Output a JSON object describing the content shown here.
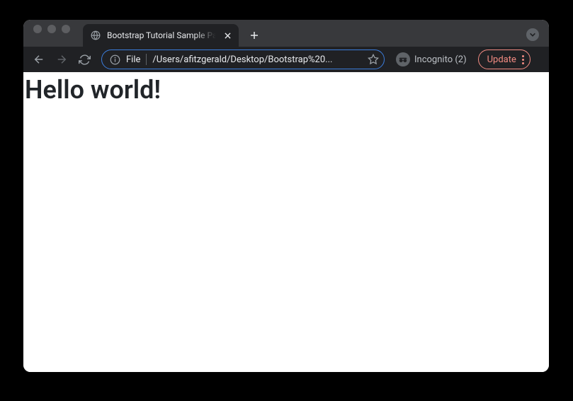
{
  "tab": {
    "title": "Bootstrap Tutorial Sample Page"
  },
  "address": {
    "scheme": "File",
    "path": "/Users/afitzgerald/Desktop/Bootstrap%20..."
  },
  "incognito": {
    "label": "Incognito (2)"
  },
  "update": {
    "label": "Update"
  },
  "page": {
    "heading": "Hello world!"
  }
}
